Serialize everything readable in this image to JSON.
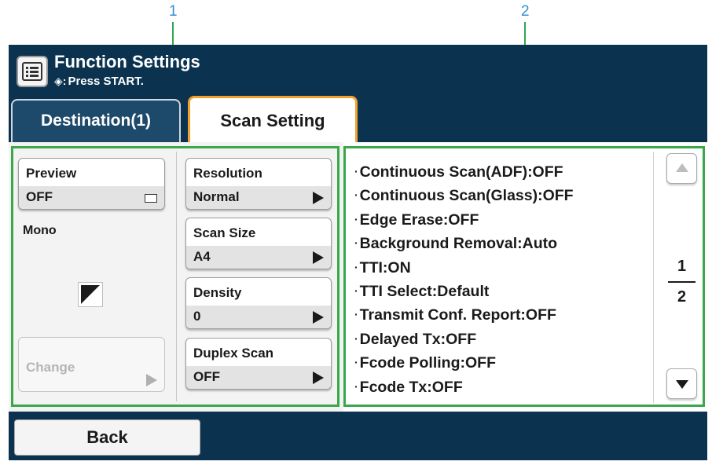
{
  "callouts": [
    "1",
    "2"
  ],
  "header": {
    "title": "Function Settings",
    "subtitle": "Press START.",
    "start_symbol": "◈:",
    "icon": "list-menu-icon"
  },
  "tabs": [
    {
      "label": "Destination(1)",
      "active": false
    },
    {
      "label": "Scan Setting",
      "active": true
    }
  ],
  "left_panel": {
    "preview": {
      "label": "Preview",
      "value": "OFF",
      "icon": "preview-square-icon"
    },
    "mono_label": "Mono",
    "color_mode_icon": "mono-color-icon",
    "change_button": {
      "label": "Change",
      "enabled": false
    }
  },
  "middle_panel": [
    {
      "label": "Resolution",
      "value": "Normal"
    },
    {
      "label": "Scan Size",
      "value": "A4"
    },
    {
      "label": "Density",
      "value": "0"
    },
    {
      "label": "Duplex Scan",
      "value": "OFF"
    }
  ],
  "settings_list": [
    "Continuous Scan(ADF):OFF",
    "Continuous Scan(Glass):OFF",
    "Edge Erase:OFF",
    "Background Removal:Auto",
    "TTI:ON",
    "TTI Select:Default",
    "Transmit Conf. Report:OFF",
    "Delayed Tx:OFF",
    "Fcode Polling:OFF",
    "Fcode Tx:OFF"
  ],
  "list_bullet": "·",
  "pagination": {
    "current": "1",
    "total": "2"
  },
  "footer": {
    "back_label": "Back"
  },
  "colors": {
    "screen_bg": "#0b3350",
    "active_tab_border": "#f2a12b",
    "callout_line": "#3aa84a",
    "callout_number": "#2f8fd0"
  }
}
